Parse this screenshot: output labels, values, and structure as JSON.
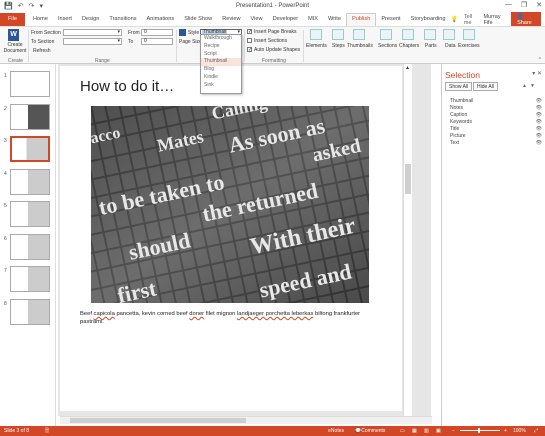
{
  "window": {
    "title": "Presentation1 - PowerPoint",
    "minimize": "—",
    "restore": "❐",
    "close": "✕"
  },
  "tabs": {
    "file": "File",
    "items": [
      "Home",
      "Insert",
      "Design",
      "Transitions",
      "Animations",
      "Slide Show",
      "Review",
      "View",
      "Developer",
      "MIX",
      "Write",
      "Publish",
      "Present",
      "Storyboarding"
    ],
    "active": "Publish",
    "tell_me": "Tell me",
    "user": "Murray Fife",
    "share": "Share"
  },
  "ribbon": {
    "create": {
      "button": "Create Document",
      "group": "Create"
    },
    "range": {
      "from_section": "From Section",
      "to_section": "To Section",
      "refresh": "Refresh",
      "from": "From",
      "from_value": "0",
      "to": "To",
      "to_value": "0",
      "group": "Range"
    },
    "style_label": "Style",
    "page_size_label": "Page Size",
    "style_value": "Thumbnail",
    "style_options": [
      "Walkthrough",
      "Recipe",
      "Script",
      "Thumbnail",
      "Blog",
      "Kindle",
      "Sink"
    ],
    "formatting": {
      "insert_page_breaks": "Insert Page Breaks",
      "insert_sections": "Insert Sections",
      "auto_update_shapes": "Auto Update Shapes",
      "group": "Formatting"
    },
    "elements": [
      "Elements",
      "Steps",
      "Thumbnails",
      "Sections",
      "Chapters",
      "Parts",
      "Data",
      "Exercises"
    ]
  },
  "thumbnails": [
    "1",
    "2",
    "3",
    "4",
    "5",
    "6",
    "7",
    "8"
  ],
  "slide": {
    "title": "How to do it…",
    "image_words": [
      "Tobacco",
      "Calling",
      "Mates",
      "As soon as",
      "asked",
      "to be taken to",
      "the returned",
      "should",
      "With their",
      "first",
      "speed and",
      "the"
    ],
    "body_pre": "Beef ",
    "body_u1": "capicola",
    "body_mid1": " pancetta, kevin corned beef ",
    "body_u2": "doner",
    "body_mid2": " filet mignon ",
    "body_u3": "landjaeger porchetta leberkas",
    "body_end": " biltong frankfurter pastrami."
  },
  "selection_pane": {
    "title": "Selection",
    "show_all": "Show All",
    "hide_all": "Hide All",
    "items": [
      "Thumbnail",
      "Notes",
      "Caption",
      "Keywords",
      "Title",
      "Picture",
      "Text"
    ]
  },
  "status": {
    "slide_info": "Slide 3 of 8",
    "notes": "Notes",
    "comments": "Comments",
    "zoom": "100%"
  },
  "colors": {
    "accent": "#d24726"
  }
}
